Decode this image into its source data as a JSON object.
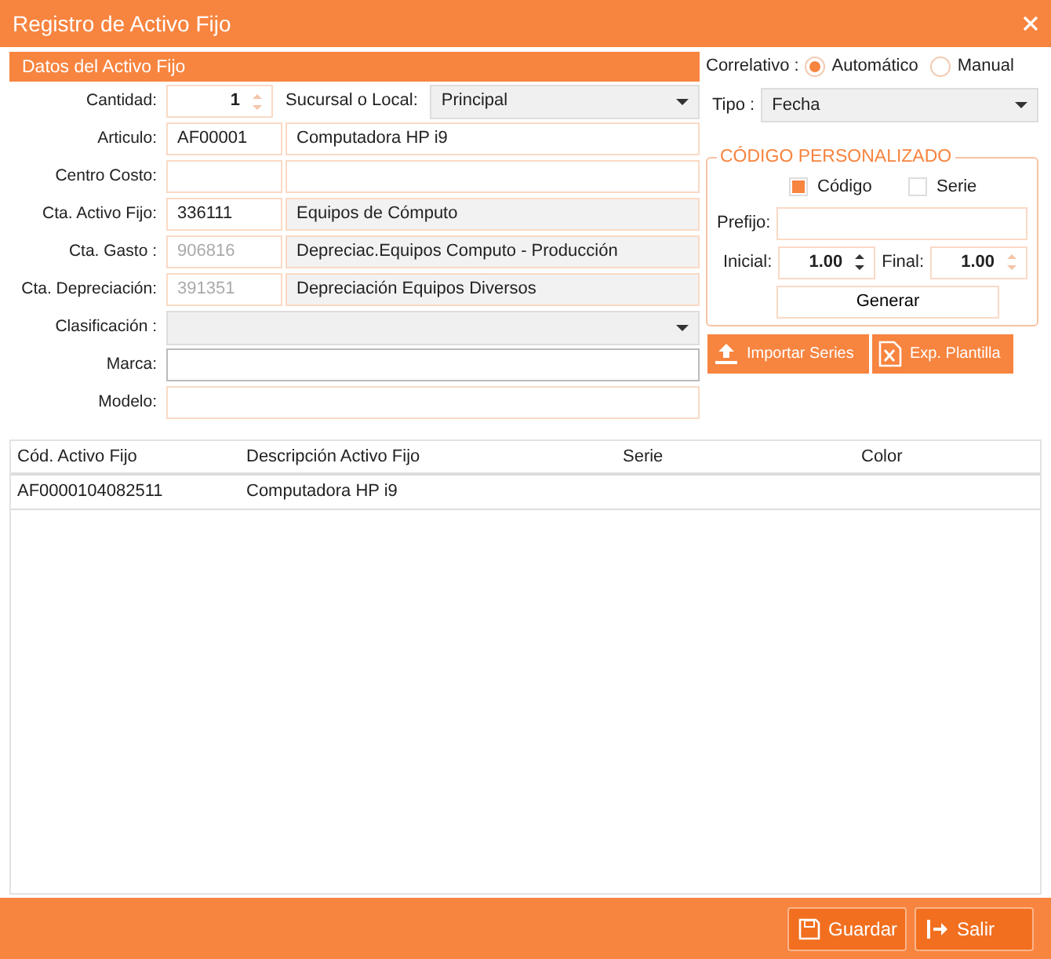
{
  "window": {
    "title": "Registro de Activo Fijo"
  },
  "form": {
    "section_title": "Datos del Activo Fijo",
    "quantity": {
      "label": "Cantidad:",
      "value": "1"
    },
    "branch": {
      "label": "Sucursal o Local:",
      "value": "Principal"
    },
    "rows": [
      {
        "kind": "pair",
        "label": "Articulo:",
        "code": "AF00001",
        "description": "Computadora HP i9",
        "disabled": false,
        "shaded": false
      },
      {
        "kind": "pair",
        "label": "Centro Costo:",
        "shaded": false
      },
      {
        "kind": "pair",
        "label": "Cta. Activo Fijo:",
        "code": "336111",
        "description": "Equipos de Cómputo",
        "disabled": false,
        "shaded": true
      },
      {
        "kind": "pair",
        "label": "Cta. Gasto :",
        "code": "906816",
        "description": "Depreciac.Equipos Computo - Producción",
        "disabled": true,
        "shaded": true
      },
      {
        "kind": "pair",
        "label": "Cta. Depreciación:",
        "code": "391351",
        "description": "Depreciación Equipos Diversos",
        "disabled": true,
        "shaded": true
      },
      {
        "kind": "select",
        "label": "Clasificación :"
      },
      {
        "kind": "text",
        "label": "Marca:",
        "focused": true
      },
      {
        "kind": "text",
        "label": "Modelo:",
        "focused": false
      }
    ]
  },
  "correlativo": {
    "label": "Correlativo :",
    "options": [
      {
        "label": "Automático",
        "selected": true
      },
      {
        "label": "Manual",
        "selected": false
      }
    ]
  },
  "tipo": {
    "label": "Tipo :",
    "value": "Fecha"
  },
  "custom_code": {
    "title": "CÓDIGO PERSONALIZADO",
    "checks": [
      {
        "label": "Código",
        "checked": true
      },
      {
        "label": "Serie",
        "checked": false
      }
    ],
    "prefix_label": "Prefijo:",
    "initial_label": "Inicial:",
    "initial_value": "1.00",
    "final_label": "Final:",
    "final_value": "1.00",
    "generate": "Generar"
  },
  "actions": [
    {
      "kind": "upload",
      "label": "Importar Series"
    },
    {
      "kind": "excel",
      "label": "Exp. Plantilla"
    }
  ],
  "table": {
    "columns": [
      "Cód. Activo Fijo",
      "Descripción Activo Fijo",
      "Serie",
      "Color"
    ],
    "rows": [
      [
        "AF0000104082511",
        "Computadora HP i9",
        "",
        ""
      ]
    ]
  },
  "footer": [
    {
      "kind": "save",
      "label": "Guardar"
    },
    {
      "kind": "exit",
      "label": "Salir"
    }
  ]
}
